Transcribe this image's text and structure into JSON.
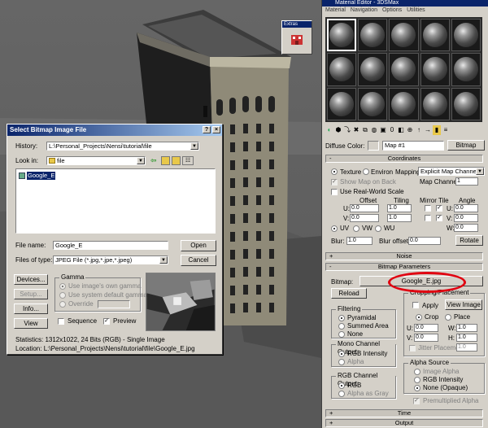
{
  "extras": {
    "title": "Extras"
  },
  "material_editor": {
    "title": "Material Editor - 3DSMax",
    "menu": [
      "Material",
      "Navigation",
      "Options",
      "Utilities"
    ],
    "diffuse_label": "Diffuse Color:",
    "map_name": "Map #1",
    "map_type": "Bitmap",
    "coordinates": {
      "header": "Coordinates",
      "texture": "Texture",
      "environ": "Environ",
      "mapping_label": "Mapping:",
      "mapping_value": "Explicit Map Channel",
      "show_map": "Show Map on Back",
      "map_channel_label": "Map Channel:",
      "map_channel_value": "1",
      "use_real": "Use Real-World Scale",
      "col_offset": "Offset",
      "col_tiling": "Tiling",
      "col_mirror": "Mirror Tile",
      "col_angle": "Angle",
      "u_label": "U:",
      "v_label": "V:",
      "w_label": "W:",
      "u_offset": "0.0",
      "u_tiling": "1.0",
      "u_angle": "0.0",
      "v_offset": "0.0",
      "v_tiling": "1.0",
      "v_angle": "0.0",
      "w_angle": "0.0",
      "uv": "UV",
      "vw": "VW",
      "wu": "WU",
      "blur_label": "Blur:",
      "blur_value": "1.0",
      "blur_offset_label": "Blur offset:",
      "blur_offset_value": "0.0",
      "rotate": "Rotate"
    },
    "noise_header": "Noise",
    "bitmap_params": {
      "header": "Bitmap Parameters",
      "bitmap_label": "Bitmap:",
      "bitmap_value": "Google_E.jpg",
      "reload": "Reload",
      "cropping_title": "Cropping/Placement",
      "apply": "Apply",
      "view_image": "View Image",
      "crop": "Crop",
      "place": "Place",
      "u_label": "U:",
      "u_value": "0.0",
      "w_label": "W:",
      "w_value": "1.0",
      "v_label": "V:",
      "v_value": "0.0",
      "h_label": "H:",
      "h_value": "1.0",
      "jitter": "Jitter Placement:",
      "jitter_value": "1.0",
      "filtering_title": "Filtering",
      "pyramidal": "Pyramidal",
      "summed": "Summed Area",
      "none": "None",
      "mono_title": "Mono Channel Output:",
      "rgb_intensity": "RGB Intensity",
      "alpha": "Alpha",
      "rgb_out_title": "RGB Channel Output:",
      "rgb": "RGB",
      "alpha_gray": "Alpha as Gray",
      "alpha_src_title": "Alpha Source",
      "image_alpha": "Image Alpha",
      "as_rgb": "RGB Intensity",
      "none_opaque": "None (Opaque)",
      "premult": "Premultiplied Alpha"
    },
    "time_header": "Time",
    "output_header": "Output"
  },
  "dialog": {
    "title": "Select Bitmap Image File",
    "history_label": "History:",
    "history_value": "L:\\Personal_Projects\\Nensi\\tutorial\\file",
    "lookin_label": "Look in:",
    "lookin_value": "file",
    "file_item": "Google_E",
    "filename_label": "File name:",
    "filename_value": "Google_E",
    "filetype_label": "Files of type:",
    "filetype_value": "JPEG File (*.jpg,*.jpe,*.jpeg)",
    "open": "Open",
    "cancel": "Cancel",
    "devices": "Devices...",
    "setup": "Setup...",
    "info": "Info...",
    "view": "View",
    "gamma_title": "Gamma",
    "gamma_own": "Use image's own gamma",
    "gamma_system": "Use system default gamma",
    "gamma_override": "Override",
    "sequence": "Sequence",
    "preview": "Preview",
    "stats": "Statistics:  1312x1022, 24 Bits (RGB) - Single Image",
    "location": "Location:  L:\\Personal_Projects\\Nensi\\tutorial\\file\\Google_E.jpg"
  }
}
